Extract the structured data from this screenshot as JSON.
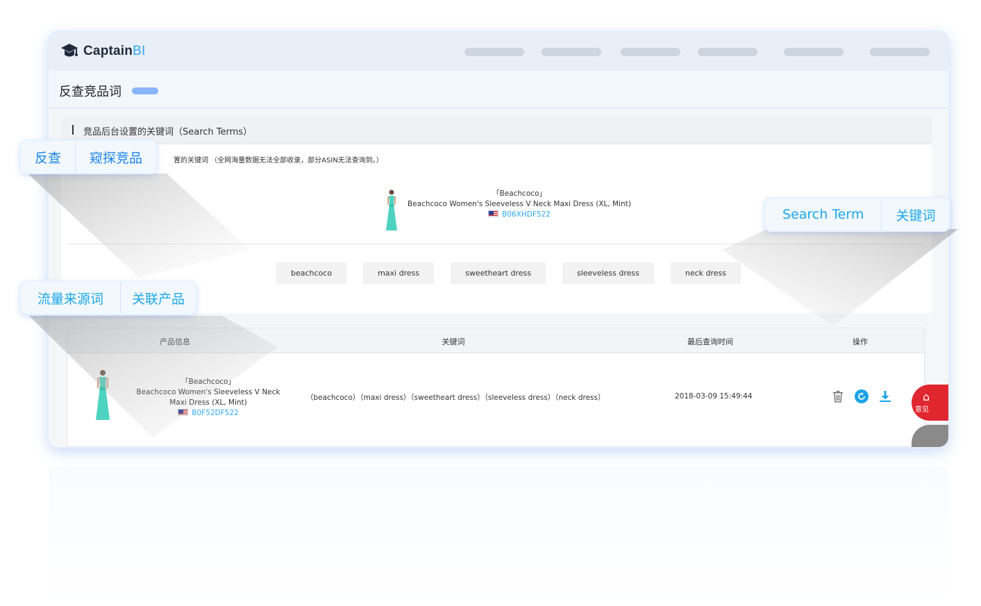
{
  "app": {
    "brand_main": "Captain",
    "brand_accent": "BI",
    "brand_color": "#2ea8f1"
  },
  "header": {
    "page_title": "反查竞品词"
  },
  "search_terms_card": {
    "title": "竞品后台设置的关键词（Search Terms）",
    "note": "置的关键词 （全网海量数据无法全部收录，部分ASIN无法查询到。）",
    "product": {
      "brand": "「Beachcoco」",
      "name": "Beachcoco Women's Sleeveless V Neck Maxi Dress (XL, Mint)",
      "asin": "B06XHDF522",
      "image_icon": "teal-maxi-dress-image",
      "flag_icon": "us-flag-icon"
    },
    "keywords": [
      "beachcoco",
      "maxi dress",
      "sweetheart dress",
      "sleeveless dress",
      "neck dress"
    ]
  },
  "history_table": {
    "columns": [
      "产品信息",
      "关键词",
      "最后查询时间",
      "操作"
    ],
    "rows": [
      {
        "brand": "「Beachcoco」",
        "name_line1": "Beachcoco Women's Sleeveless V Neck",
        "name_line2": "Maxi Dress (XL, Mint)",
        "asin": "B0F52DF522",
        "keywords": "（beachcoco）（maxi dress）（sweetheart dress）（sleeveless dress）（neck dress）",
        "last_query_time": "2018-03-09 15:49:44",
        "actions": [
          "trash-icon",
          "refresh-icon",
          "download-icon"
        ]
      }
    ]
  },
  "feedback": {
    "label": "意见"
  },
  "callouts": {
    "a": [
      "反查",
      "窥探竞品"
    ],
    "b": [
      "Search Term",
      "关键词"
    ],
    "c": [
      "流量来源词",
      "关联产品"
    ]
  }
}
